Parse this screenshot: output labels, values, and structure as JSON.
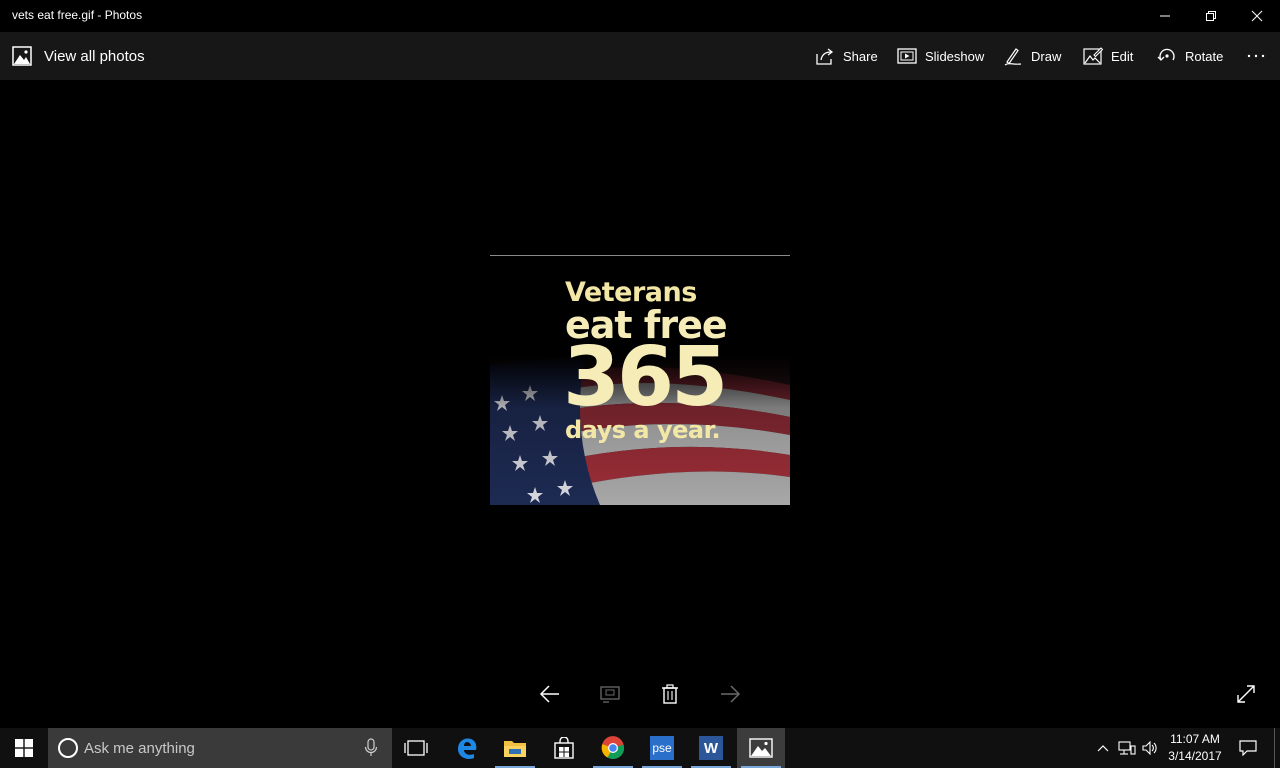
{
  "window": {
    "title": "vets eat free.gif - Photos"
  },
  "appbar": {
    "view_all_label": "View all photos",
    "commands": [
      {
        "label": "Share",
        "icon": "share-icon"
      },
      {
        "label": "Slideshow",
        "icon": "slideshow-icon"
      },
      {
        "label": "Draw",
        "icon": "draw-icon"
      },
      {
        "label": "Edit",
        "icon": "edit-icon"
      },
      {
        "label": "Rotate",
        "icon": "rotate-icon"
      }
    ],
    "more_icon": "more-icon"
  },
  "photo": {
    "line1": "Veterans",
    "line2": "eat free",
    "line3": "365",
    "line4": "days a year."
  },
  "controls": {
    "previous_icon": "arrow-left-icon",
    "tag_icon": "edit-tags-icon",
    "delete_icon": "trash-icon",
    "next_icon": "arrow-right-icon",
    "fullscreen_icon": "fullscreen-icon"
  },
  "taskbar": {
    "search_placeholder": "Ask me anything",
    "apps": [
      "task-view",
      "edge",
      "file-explorer",
      "store",
      "chrome",
      "pse",
      "word",
      "photos"
    ],
    "pse_label": "pse",
    "word_label": "W",
    "clock_time": "11:07 AM",
    "clock_date": "3/14/2017"
  },
  "colors": {
    "titlebar": "#000000",
    "appbar": "#171717",
    "taskbar": "#101010",
    "accent": "#7aa7d9"
  }
}
